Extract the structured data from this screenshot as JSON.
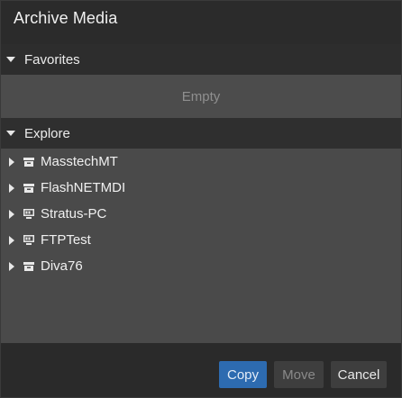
{
  "dialog": {
    "title": "Archive Media"
  },
  "favorites": {
    "label": "Favorites",
    "empty_text": "Empty"
  },
  "explore": {
    "label": "Explore",
    "items": [
      {
        "label": "MasstechMT",
        "icon": "archive-box-icon"
      },
      {
        "label": "FlashNETMDI",
        "icon": "archive-box-icon"
      },
      {
        "label": "Stratus-PC",
        "icon": "computer-icon"
      },
      {
        "label": "FTPTest",
        "icon": "computer-icon"
      },
      {
        "label": "Diva76",
        "icon": "archive-box-icon"
      }
    ]
  },
  "buttons": {
    "copy": "Copy",
    "move": "Move",
    "cancel": "Cancel"
  },
  "colors": {
    "accent": "#2d6bb0",
    "background": "#2b2b2b",
    "panel": "#4a4a4a"
  }
}
